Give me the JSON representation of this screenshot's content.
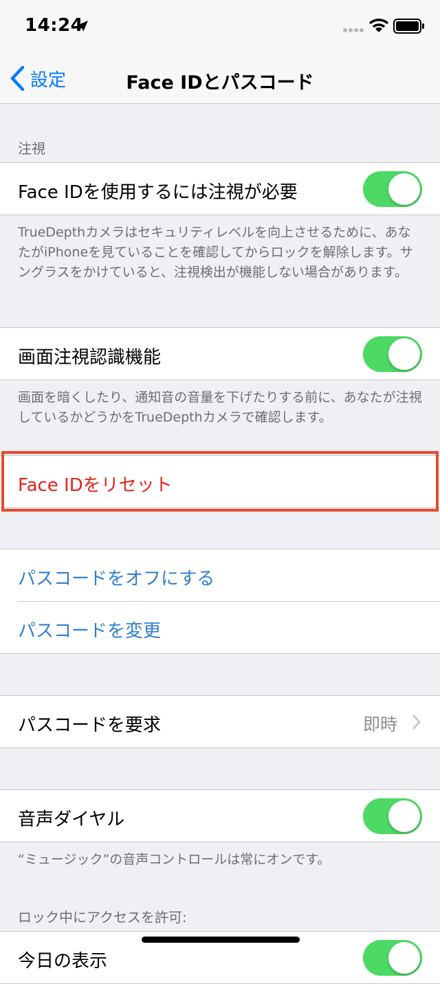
{
  "status": {
    "time": "14:24"
  },
  "nav": {
    "back_label": "設定",
    "title": "Face IDとパスコード"
  },
  "attention": {
    "header": "注視",
    "require_label": "Face IDを使用するには注視が必要",
    "require_on": true,
    "require_footer": "TrueDepthカメラはセキュリティレベルを向上させるために、あなたがiPhoneを見ていることを確認してからロックを解除します。サングラスをかけていると、注視検出が機能しない場合があります。",
    "aware_label": "画面注視認識機能",
    "aware_on": true,
    "aware_footer": "画面を暗くしたり、通知音の音量を下げたりする前に、あなたが注視しているかどうかをTrueDepthカメラで確認します。"
  },
  "reset_face_id": "Face IDをリセット",
  "passcode": {
    "turn_off": "パスコードをオフにする",
    "change": "パスコードを変更",
    "require_label": "パスコードを要求",
    "require_value": "即時"
  },
  "voice_dial": {
    "label": "音声ダイヤル",
    "on": true,
    "footer": "“ミュージック”の音声コントロールは常にオンです。"
  },
  "lock_access": {
    "header": "ロック中にアクセスを許可:",
    "first_item": "今日の表示"
  },
  "colors": {
    "accent_blue": "#2f7fce",
    "destructive_red": "#e2231a",
    "toggle_green": "#4cd964",
    "highlight": "#e8492d"
  }
}
